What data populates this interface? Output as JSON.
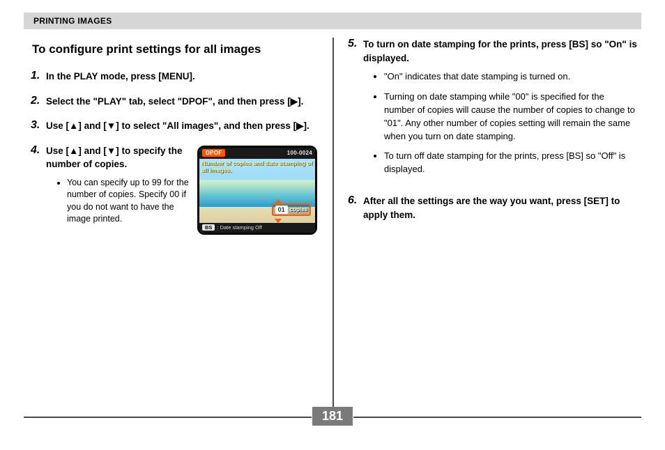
{
  "header": {
    "section": "PRINTING IMAGES"
  },
  "title": "To configure print settings for all images",
  "steps": {
    "s1": {
      "num": "1.",
      "text": "In the PLAY mode, press [MENU]."
    },
    "s2": {
      "num": "2.",
      "text": "Select the \"PLAY\" tab, select \"DPOF\", and then press [▶]."
    },
    "s3": {
      "num": "3.",
      "text": "Use [▲] and [▼] to select \"All images\", and then press [▶]."
    },
    "s4": {
      "num": "4.",
      "text": "Use [▲] and [▼] to specify the number of copies.",
      "bullets": [
        "You can specify up to 99 for the number of copies. Specify 00 if you do not want to have the image printed."
      ]
    },
    "s5": {
      "num": "5.",
      "text": "To turn on date stamping for the prints, press [BS] so \"On\" is displayed.",
      "bullets": [
        "\"On\" indicates that date stamping is turned on.",
        "Turning on date stamping while \"00\" is specified for the number of copies will cause the number of copies to change to \"01\". Any other number of copies setting will remain the same when you turn on date stamping.",
        "To turn off date stamping for the prints, press [BS] so \"Off\" is displayed."
      ]
    },
    "s6": {
      "num": "6.",
      "text": "After all the settings are the way you want, press [SET] to apply them."
    }
  },
  "camera_screen": {
    "dpof_label": "DPOF",
    "image_id": "100-0024",
    "message": "Number of copies and date stamping of all images.",
    "copies_value": "01",
    "copies_label": "copies",
    "bs_label": "BS",
    "bottom_text": ": Date stamping Off"
  },
  "page_number": "181"
}
